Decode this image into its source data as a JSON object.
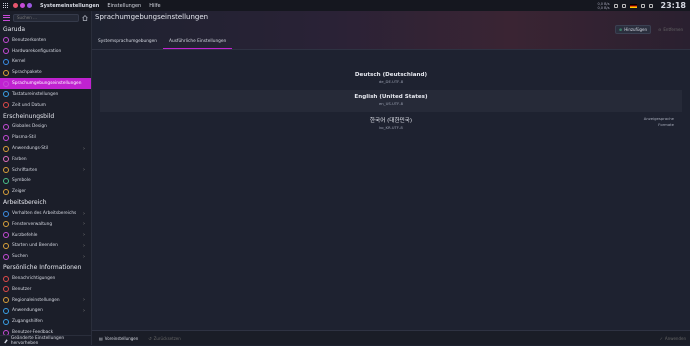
{
  "topbar": {
    "menu": [
      "Systemeinstellungen",
      "Einstellungen",
      "Hilfe"
    ],
    "net_down": "0,0 B/s",
    "net_up": "0,0 B/s",
    "clock": "23:18"
  },
  "sidebar": {
    "search_placeholder": "Suchen ...",
    "categories": [
      {
        "title": "Garuda",
        "items": [
          {
            "label": "Benutzerkonten",
            "color": "#c54bd6"
          },
          {
            "label": "Hardwarekonfiguration",
            "color": "#c54bd6"
          },
          {
            "label": "Kernel",
            "color": "#3a8ee6"
          },
          {
            "label": "Sprachpakete",
            "color": "#d8a03a"
          },
          {
            "label": "Sprachumgebungseinstellungen",
            "color": "#c54bd6",
            "active": true
          },
          {
            "label": "Tastatureinstellungen",
            "color": "#3aa0e6"
          },
          {
            "label": "Zeit und Datum",
            "color": "#e04a4a"
          }
        ]
      },
      {
        "title": "Erscheinungsbild",
        "items": [
          {
            "label": "Globales Design",
            "color": "#c54bd6"
          },
          {
            "label": "Plasma-Stil",
            "color": "#c54bd6"
          },
          {
            "label": "Anwendungs-Stil",
            "color": "#d8a03a",
            "chevron": true
          },
          {
            "label": "Farben",
            "color": "#e070c0"
          },
          {
            "label": "Schriftarten",
            "color": "#d8a03a",
            "chevron": true
          },
          {
            "label": "Symbole",
            "color": "#4ac08a"
          },
          {
            "label": "Zeiger",
            "color": "#d8a03a"
          }
        ]
      },
      {
        "title": "Arbeitsbereich",
        "items": [
          {
            "label": "Verhalten des Arbeitsbereichs",
            "color": "#3a8ee6",
            "chevron": true
          },
          {
            "label": "Fensterverwaltung",
            "color": "#d8a03a",
            "chevron": true
          },
          {
            "label": "Kurzbefehle",
            "color": "#c54bd6",
            "chevron": true
          },
          {
            "label": "Starten und Beenden",
            "color": "#d8a03a",
            "chevron": true
          },
          {
            "label": "Suchen",
            "color": "#c54bd6",
            "chevron": true
          }
        ]
      },
      {
        "title": "Persönliche Informationen",
        "items": [
          {
            "label": "Benachrichtigungen",
            "color": "#e04a4a"
          },
          {
            "label": "Benutzer",
            "color": "#e04a4a"
          },
          {
            "label": "Regionaleinstellungen",
            "color": "#d8a03a",
            "chevron": true
          },
          {
            "label": "Anwendungen",
            "color": "#3aa0e6",
            "chevron": true
          },
          {
            "label": "Zugangshilfen",
            "color": "#3aa0e6"
          },
          {
            "label": "Benutzer-Feedback",
            "color": "#c54bd6"
          }
        ]
      }
    ],
    "footer": "Geänderte Einstellungen hervorheben"
  },
  "main": {
    "title": "Sprachumgebungseinstellungen",
    "add_label": "Hinzufügen",
    "remove_label": "Entfernen",
    "tabs": [
      "Systemsprachumgebungen",
      "Ausführliche Einstellungen"
    ],
    "languages": [
      {
        "name": "Deutsch (Deutschland)",
        "code": "de_DE.UTF-8"
      },
      {
        "name": "English (United States)",
        "code": "en_US.UTF-8"
      },
      {
        "name": "한국어 (대한민국)",
        "code": "ko_KR.UTF-8",
        "tag1": "Anzeigesprache",
        "tag2": "Formate"
      }
    ],
    "defaults_label": "Voreinstellungen",
    "reset_label": "Zurücksetzen",
    "apply_label": "Anwenden"
  }
}
